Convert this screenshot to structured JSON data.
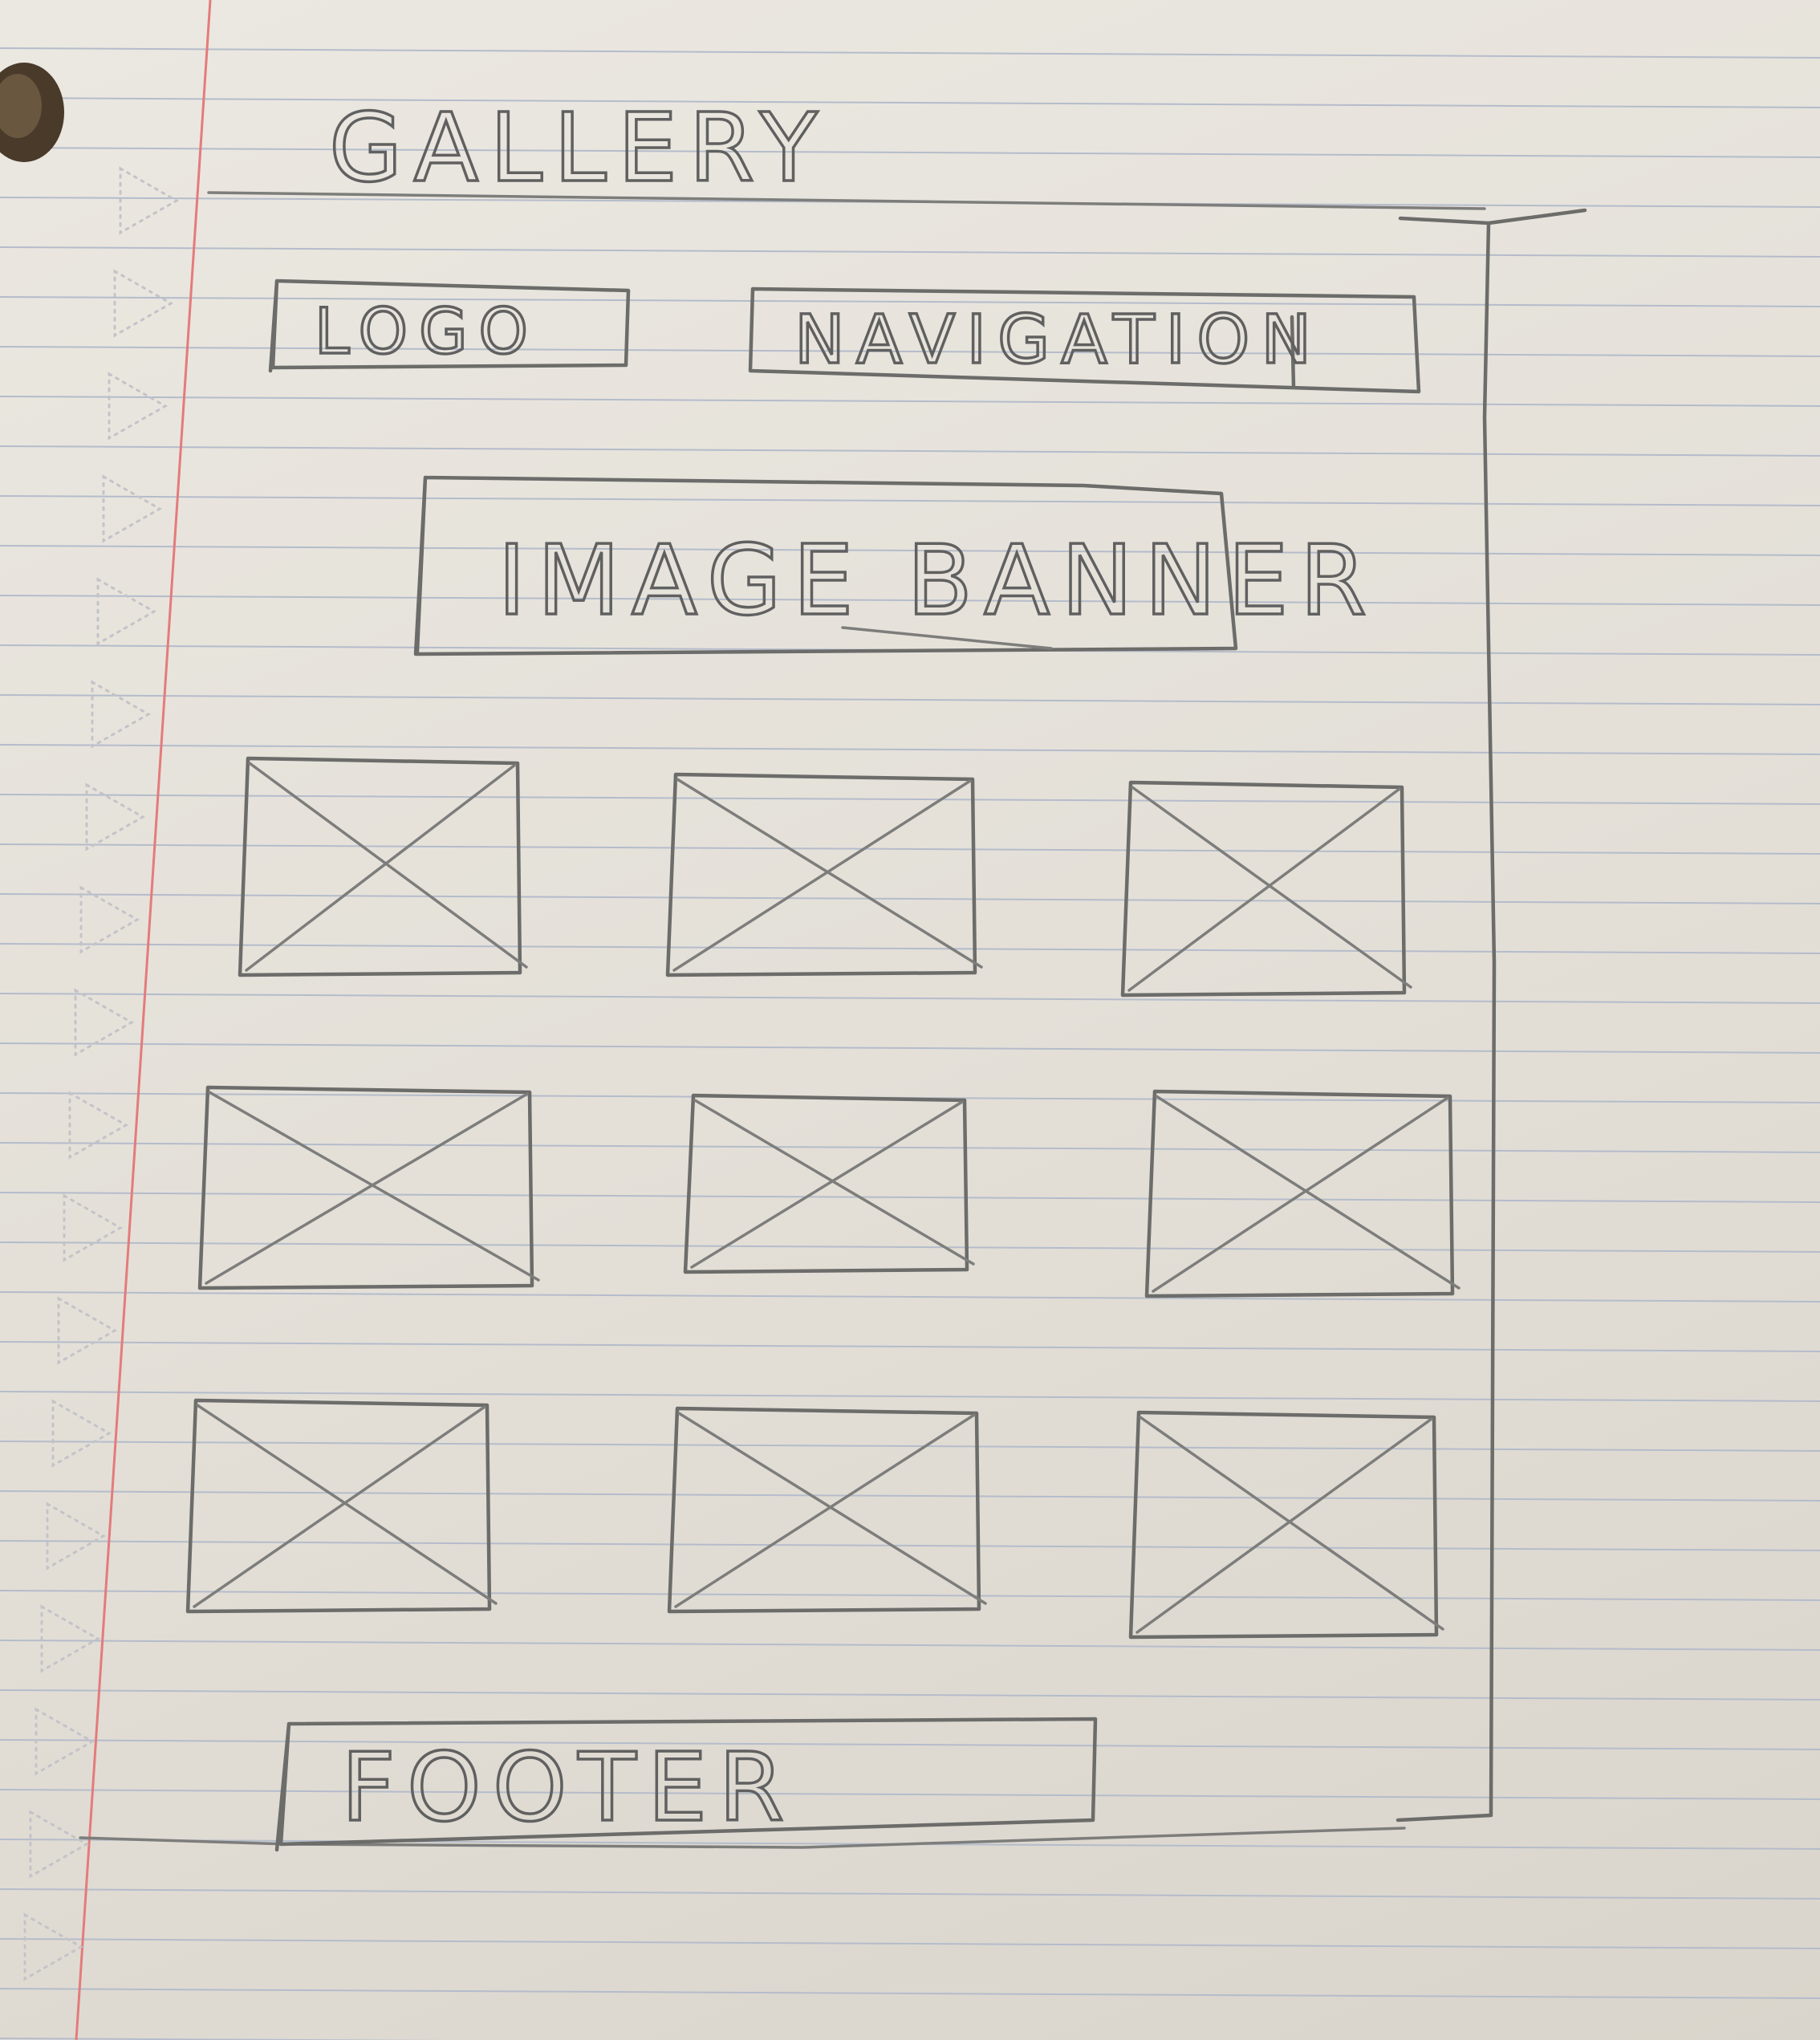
{
  "wireframe": {
    "page_title": "GALLERY",
    "header": {
      "logo_label": "LOGO",
      "navigation_label": "NAVIGATION"
    },
    "banner_label": "IMAGE BANNER",
    "gallery": {
      "rows": 3,
      "columns": 3,
      "placeholder_count": 9,
      "placeholder_icon": "crossed-box-image-placeholder"
    },
    "footer_label": "FOOTER"
  },
  "colors": {
    "pencil": "#6c6c6a",
    "paper": "#e4e0d8",
    "rule_lines": "#b4bccb",
    "margin_line": "#e47b7b"
  }
}
